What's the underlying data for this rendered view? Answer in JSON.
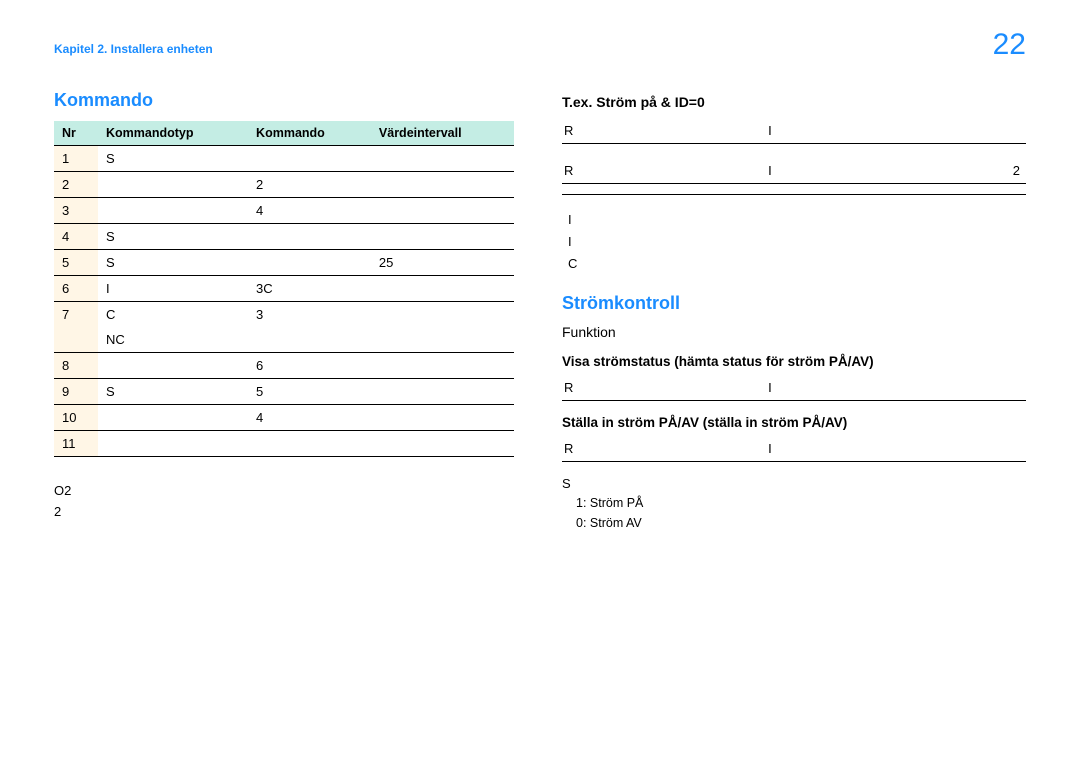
{
  "header": {
    "breadcrumb": "Kapitel 2. Installera enheten",
    "page_number": "22"
  },
  "left": {
    "section_title": "Kommando",
    "table_headers": {
      "nr": "Nr",
      "typ": "Kommandotyp",
      "cmd": "Kommando",
      "range": "Värdeintervall"
    },
    "rows": [
      {
        "nr": "1",
        "typ": "S",
        "cmd": "",
        "range": ""
      },
      {
        "nr": "2",
        "typ": "",
        "cmd": "2",
        "range": ""
      },
      {
        "nr": "3",
        "typ": "",
        "cmd": "4",
        "range": ""
      },
      {
        "nr": "4",
        "typ": "S",
        "cmd": "",
        "range": ""
      },
      {
        "nr": "5",
        "typ": "S",
        "cmd": "",
        "range": "25"
      },
      {
        "nr": "6",
        "typ": "I",
        "cmd": "3C",
        "range": ""
      },
      {
        "nr": "7",
        "typ": "C",
        "cmd": "3",
        "range": ""
      },
      {
        "nr": "",
        "typ": "NC",
        "cmd": "",
        "range": ""
      },
      {
        "nr": "8",
        "typ": "",
        "cmd": "6",
        "range": ""
      },
      {
        "nr": "9",
        "typ": "S",
        "cmd": "5",
        "range": ""
      },
      {
        "nr": "10",
        "typ": "",
        "cmd": "4",
        "range": ""
      },
      {
        "nr": "11",
        "typ": "",
        "cmd": "",
        "range": ""
      }
    ],
    "footnote_line1": "O2",
    "footnote_line2": "2"
  },
  "right": {
    "ex_title": "T.ex. Ström på & ID=0",
    "kv1": [
      {
        "label": "R",
        "vbar": "I",
        "val": ""
      }
    ],
    "kv2": [
      {
        "label": "R",
        "vbar": "I",
        "val": "2"
      },
      {
        "label": "",
        "vbar": "",
        "val": ""
      }
    ],
    "list_items": [
      "I",
      "I",
      "C"
    ],
    "section_title": "Strömkontroll",
    "func_label": "Funktion",
    "visa_line": "Visa strömstatus (hämta status för ström PÅ/AV)",
    "kv3": [
      {
        "label": "R",
        "vbar": "I",
        "val": ""
      }
    ],
    "stalla_line": "Ställa in ström PÅ/AV (ställa in ström PÅ/AV)",
    "kv4": [
      {
        "label": "R",
        "vbar": "I",
        "val": ""
      }
    ],
    "s_label": "S",
    "s_items": [
      "1: Ström PÅ",
      "0: Ström AV"
    ]
  }
}
